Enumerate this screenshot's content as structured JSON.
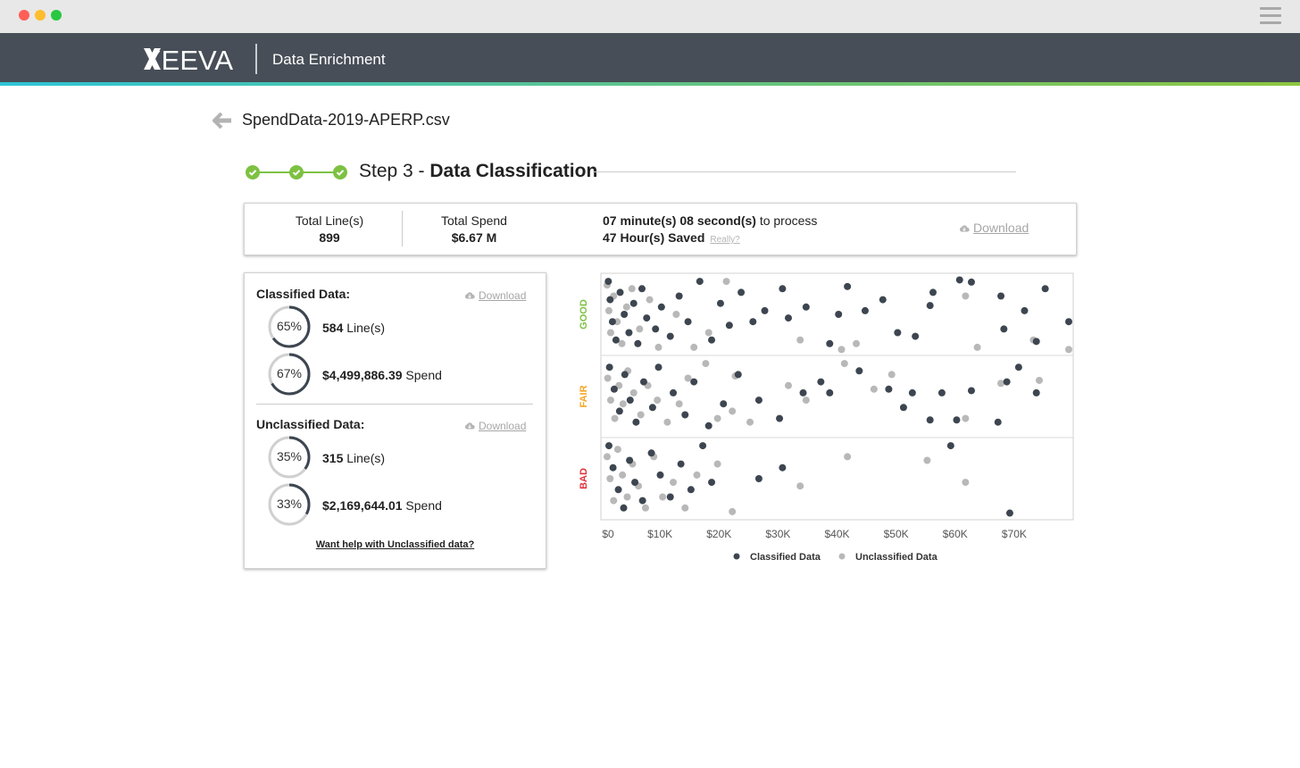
{
  "app": {
    "logo_text": "XEEVA",
    "title": "Data Enrichment"
  },
  "file": {
    "name": "SpendData-2019-APERP.csv"
  },
  "step": {
    "prefix": "Step 3 -",
    "name": "Data Classification",
    "completed_steps": 3,
    "color": "#7dc142"
  },
  "summary": {
    "total_lines_label": "Total Line(s)",
    "total_lines_value": "899",
    "total_spend_label": "Total Spend",
    "total_spend_value": "$6.67 M",
    "process_time": "07 minute(s) 08 second(s)",
    "process_suffix": " to process",
    "hours_saved": "47 Hour(s) Saved",
    "really_link": "Really?",
    "download_label": "Download"
  },
  "classified": {
    "heading": "Classified Data:",
    "download_label": "Download",
    "lines_percent": "65%",
    "lines_fraction": 0.65,
    "lines_value": "584",
    "lines_unit": " Line(s)",
    "spend_percent": "67%",
    "spend_fraction": 0.67,
    "spend_value": "$4,499,886.39",
    "spend_unit": " Spend"
  },
  "unclassified": {
    "heading": "Unclassified Data:",
    "download_label": "Download",
    "lines_percent": "35%",
    "lines_fraction": 0.35,
    "lines_value": "315",
    "lines_unit": " Line(s)",
    "spend_percent": "33%",
    "spend_fraction": 0.33,
    "spend_value": "$2,169,644.01",
    "spend_unit": " Spend"
  },
  "help_link": "Want help with Unclassified data?",
  "colors": {
    "header_bg": "#474e57",
    "ring_fill": "#3d4650",
    "ring_track": "#d0d0d0",
    "good": "#7dc142",
    "fair": "#f5a623",
    "bad": "#e0303a"
  },
  "chart_data": {
    "type": "scatter",
    "x_ticks": [
      "$0",
      "$10K",
      "$20K",
      "$30K",
      "$40K",
      "$50K",
      "$60K",
      "$70K"
    ],
    "xlim": [
      0,
      80000
    ],
    "y_categories": [
      "GOOD",
      "FAIR",
      "BAD"
    ],
    "legend_position": "bottom",
    "series": [
      {
        "name": "Classified Data",
        "color": "#3d4650",
        "points": [
          [
            500,
            "GOOD",
            0.05
          ],
          [
            800,
            "GOOD",
            0.3
          ],
          [
            1200,
            "GOOD",
            0.6
          ],
          [
            1800,
            "GOOD",
            0.85
          ],
          [
            2500,
            "GOOD",
            0.2
          ],
          [
            3200,
            "GOOD",
            0.5
          ],
          [
            4000,
            "GOOD",
            0.75
          ],
          [
            4800,
            "GOOD",
            0.35
          ],
          [
            5500,
            "GOOD",
            0.9
          ],
          [
            6200,
            "GOOD",
            0.15
          ],
          [
            7000,
            "GOOD",
            0.55
          ],
          [
            8500,
            "GOOD",
            0.7
          ],
          [
            9500,
            "GOOD",
            0.4
          ],
          [
            11000,
            "GOOD",
            0.8
          ],
          [
            12500,
            "GOOD",
            0.25
          ],
          [
            14000,
            "GOOD",
            0.6
          ],
          [
            16000,
            "GOOD",
            0.05
          ],
          [
            18000,
            "GOOD",
            0.85
          ],
          [
            19500,
            "GOOD",
            0.35
          ],
          [
            21000,
            "GOOD",
            0.65
          ],
          [
            23000,
            "GOOD",
            0.2
          ],
          [
            25000,
            "GOOD",
            0.6
          ],
          [
            27000,
            "GOOD",
            0.45
          ],
          [
            30000,
            "GOOD",
            0.15
          ],
          [
            31000,
            "GOOD",
            0.55
          ],
          [
            34000,
            "GOOD",
            0.4
          ],
          [
            38000,
            "GOOD",
            0.9
          ],
          [
            39500,
            "GOOD",
            0.5
          ],
          [
            41000,
            "GOOD",
            0.12
          ],
          [
            44000,
            "GOOD",
            0.45
          ],
          [
            47000,
            "GOOD",
            0.3
          ],
          [
            49500,
            "GOOD",
            0.75
          ],
          [
            52500,
            "GOOD",
            0.8
          ],
          [
            55500,
            "GOOD",
            0.2
          ],
          [
            55000,
            "GOOD",
            0.38
          ],
          [
            60000,
            "GOOD",
            0.03
          ],
          [
            62000,
            "GOOD",
            0.06
          ],
          [
            67000,
            "GOOD",
            0.25
          ],
          [
            67500,
            "GOOD",
            0.7
          ],
          [
            71000,
            "GOOD",
            0.45
          ],
          [
            73000,
            "GOOD",
            0.87
          ],
          [
            74500,
            "GOOD",
            0.15
          ],
          [
            78500,
            "GOOD",
            0.6
          ],
          [
            700,
            "FAIR",
            0.1
          ],
          [
            1500,
            "FAIR",
            0.4
          ],
          [
            2400,
            "FAIR",
            0.7
          ],
          [
            3300,
            "FAIR",
            0.2
          ],
          [
            4200,
            "FAIR",
            0.55
          ],
          [
            5200,
            "FAIR",
            0.85
          ],
          [
            6500,
            "FAIR",
            0.3
          ],
          [
            8000,
            "FAIR",
            0.65
          ],
          [
            9000,
            "FAIR",
            0.1
          ],
          [
            11500,
            "FAIR",
            0.45
          ],
          [
            13500,
            "FAIR",
            0.75
          ],
          [
            15000,
            "FAIR",
            0.3
          ],
          [
            17500,
            "FAIR",
            0.9
          ],
          [
            20000,
            "FAIR",
            0.6
          ],
          [
            22500,
            "FAIR",
            0.2
          ],
          [
            26000,
            "FAIR",
            0.55
          ],
          [
            29500,
            "FAIR",
            0.8
          ],
          [
            33500,
            "FAIR",
            0.45
          ],
          [
            36500,
            "FAIR",
            0.3
          ],
          [
            38000,
            "FAIR",
            0.45
          ],
          [
            43000,
            "FAIR",
            0.15
          ],
          [
            48000,
            "FAIR",
            0.4
          ],
          [
            50500,
            "FAIR",
            0.65
          ],
          [
            52000,
            "FAIR",
            0.45
          ],
          [
            57000,
            "FAIR",
            0.45
          ],
          [
            62000,
            "FAIR",
            0.42
          ],
          [
            68000,
            "FAIR",
            0.3
          ],
          [
            70000,
            "FAIR",
            0.1
          ],
          [
            73000,
            "FAIR",
            0.45
          ],
          [
            59500,
            "FAIR",
            0.82
          ],
          [
            55000,
            "FAIR",
            0.82
          ],
          [
            66500,
            "FAIR",
            0.85
          ],
          [
            600,
            "BAD",
            0.05
          ],
          [
            1300,
            "BAD",
            0.35
          ],
          [
            2200,
            "BAD",
            0.65
          ],
          [
            3100,
            "BAD",
            0.9
          ],
          [
            4100,
            "BAD",
            0.25
          ],
          [
            5000,
            "BAD",
            0.55
          ],
          [
            6300,
            "BAD",
            0.8
          ],
          [
            7800,
            "BAD",
            0.15
          ],
          [
            9300,
            "BAD",
            0.45
          ],
          [
            11000,
            "BAD",
            0.75
          ],
          [
            12800,
            "BAD",
            0.3
          ],
          [
            14500,
            "BAD",
            0.65
          ],
          [
            16500,
            "BAD",
            0.05
          ],
          [
            18000,
            "BAD",
            0.55
          ],
          [
            26000,
            "BAD",
            0.5
          ],
          [
            30000,
            "BAD",
            0.35
          ],
          [
            68500,
            "BAD",
            0.97
          ],
          [
            58500,
            "BAD",
            0.05
          ]
        ]
      },
      {
        "name": "Unclassified Data",
        "color": "#b8b8b8",
        "points": [
          [
            300,
            "GOOD",
            0.1
          ],
          [
            600,
            "GOOD",
            0.45
          ],
          [
            900,
            "GOOD",
            0.75
          ],
          [
            1400,
            "GOOD",
            0.25
          ],
          [
            2000,
            "GOOD",
            0.6
          ],
          [
            2800,
            "GOOD",
            0.9
          ],
          [
            3600,
            "GOOD",
            0.4
          ],
          [
            4500,
            "GOOD",
            0.15
          ],
          [
            5800,
            "GOOD",
            0.7
          ],
          [
            7500,
            "GOOD",
            0.3
          ],
          [
            9000,
            "GOOD",
            0.95
          ],
          [
            12000,
            "GOOD",
            0.5
          ],
          [
            15000,
            "GOOD",
            0.95
          ],
          [
            17500,
            "GOOD",
            0.75
          ],
          [
            20500,
            "GOOD",
            0.05
          ],
          [
            33000,
            "GOOD",
            0.85
          ],
          [
            40000,
            "GOOD",
            0.98
          ],
          [
            42500,
            "GOOD",
            0.9
          ],
          [
            61000,
            "GOOD",
            0.25
          ],
          [
            63000,
            "GOOD",
            0.95
          ],
          [
            72500,
            "GOOD",
            0.85
          ],
          [
            78500,
            "GOOD",
            0.98
          ],
          [
            400,
            "FAIR",
            0.25
          ],
          [
            900,
            "FAIR",
            0.55
          ],
          [
            1600,
            "FAIR",
            0.8
          ],
          [
            2300,
            "FAIR",
            0.35
          ],
          [
            3000,
            "FAIR",
            0.6
          ],
          [
            3800,
            "FAIR",
            0.15
          ],
          [
            4800,
            "FAIR",
            0.45
          ],
          [
            6000,
            "FAIR",
            0.75
          ],
          [
            7200,
            "FAIR",
            0.35
          ],
          [
            8800,
            "FAIR",
            0.55
          ],
          [
            10500,
            "FAIR",
            0.85
          ],
          [
            12500,
            "FAIR",
            0.6
          ],
          [
            14000,
            "FAIR",
            0.25
          ],
          [
            17000,
            "FAIR",
            0.05
          ],
          [
            19000,
            "FAIR",
            0.8
          ],
          [
            22000,
            "FAIR",
            0.22
          ],
          [
            24500,
            "FAIR",
            0.85
          ],
          [
            31000,
            "FAIR",
            0.35
          ],
          [
            34000,
            "FAIR",
            0.55
          ],
          [
            40500,
            "FAIR",
            0.05
          ],
          [
            45500,
            "FAIR",
            0.4
          ],
          [
            48500,
            "FAIR",
            0.2
          ],
          [
            61000,
            "FAIR",
            0.8
          ],
          [
            67000,
            "FAIR",
            0.32
          ],
          [
            73500,
            "FAIR",
            0.28
          ],
          [
            21500,
            "FAIR",
            0.7
          ],
          [
            300,
            "BAD",
            0.2
          ],
          [
            800,
            "BAD",
            0.5
          ],
          [
            1400,
            "BAD",
            0.8
          ],
          [
            2100,
            "BAD",
            0.1
          ],
          [
            2900,
            "BAD",
            0.45
          ],
          [
            3700,
            "BAD",
            0.75
          ],
          [
            4600,
            "BAD",
            0.3
          ],
          [
            5600,
            "BAD",
            0.6
          ],
          [
            6800,
            "BAD",
            0.9
          ],
          [
            8200,
            "BAD",
            0.2
          ],
          [
            9700,
            "BAD",
            0.75
          ],
          [
            11500,
            "BAD",
            0.55
          ],
          [
            13500,
            "BAD",
            0.9
          ],
          [
            15500,
            "BAD",
            0.45
          ],
          [
            19000,
            "BAD",
            0.3
          ],
          [
            21500,
            "BAD",
            0.95
          ],
          [
            33000,
            "BAD",
            0.6
          ],
          [
            41000,
            "BAD",
            0.2
          ],
          [
            54500,
            "BAD",
            0.25
          ],
          [
            61000,
            "BAD",
            0.55
          ]
        ]
      }
    ]
  }
}
